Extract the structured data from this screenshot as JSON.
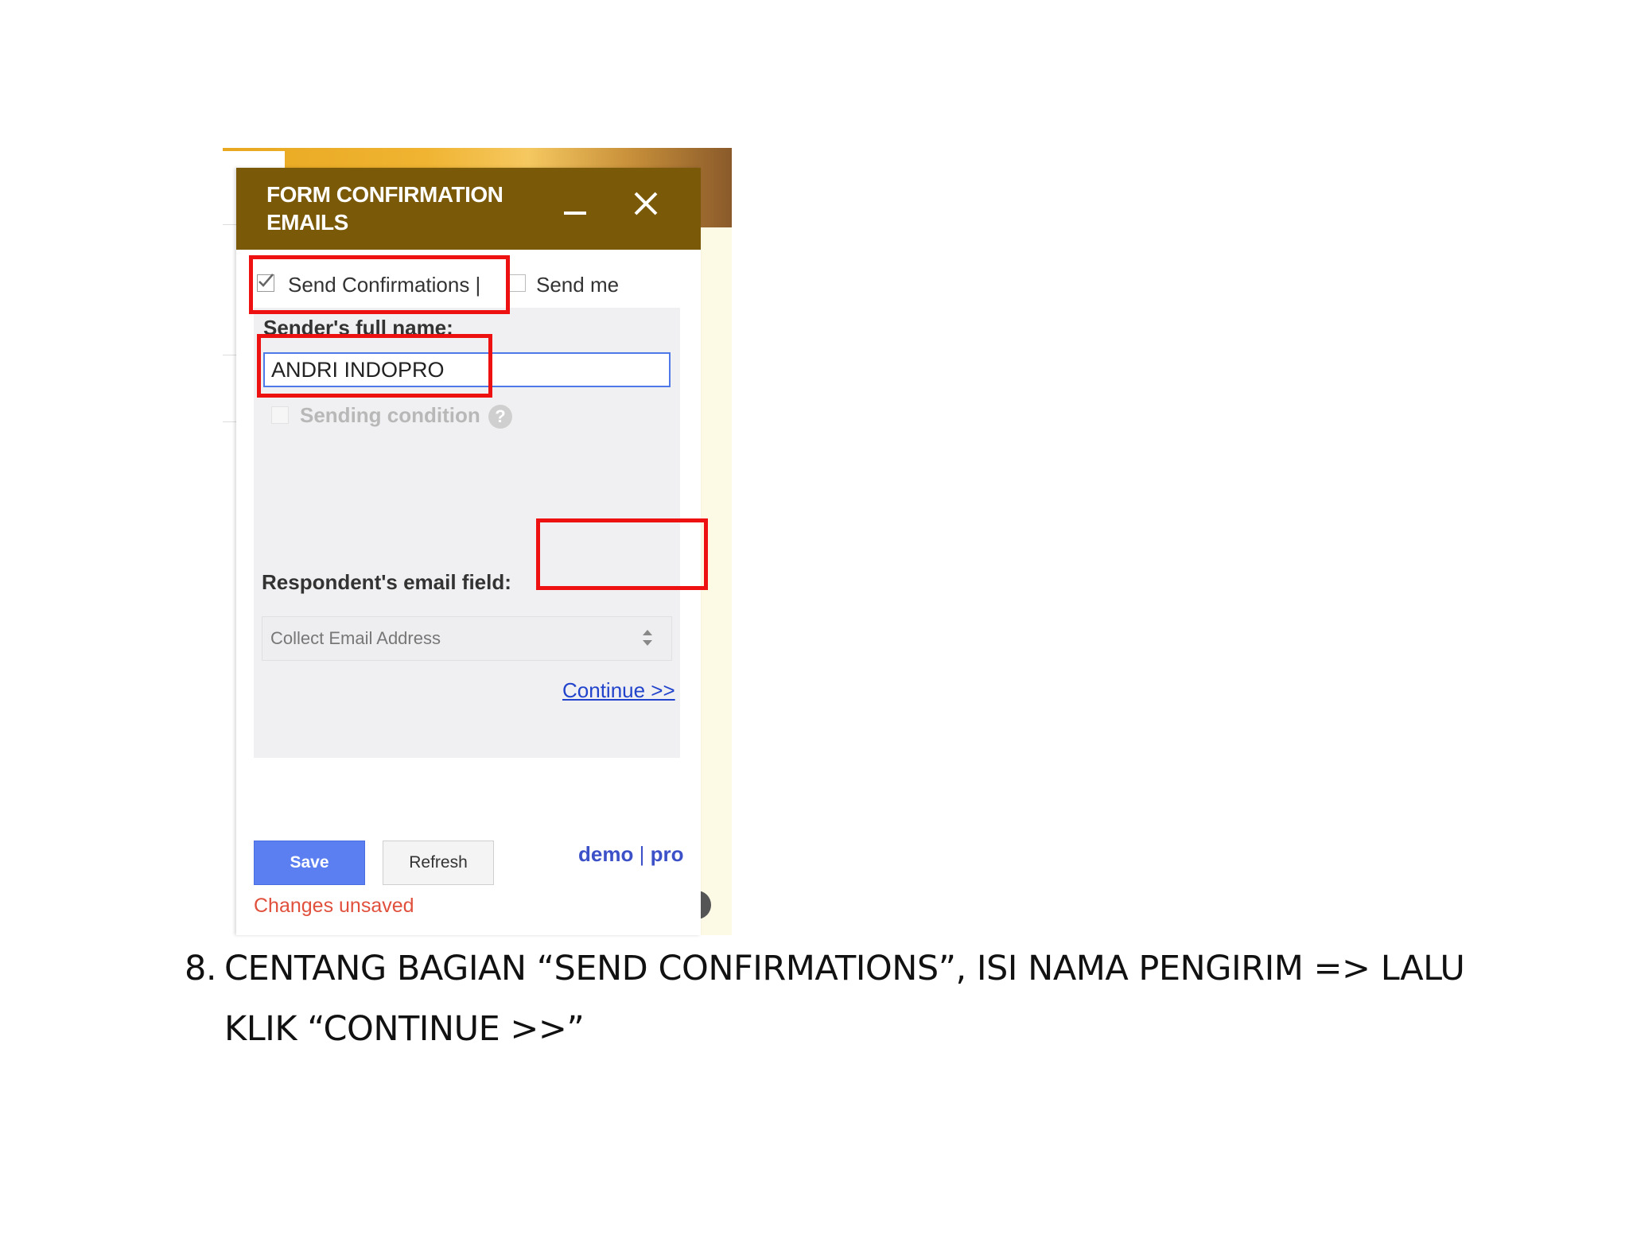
{
  "dialog": {
    "title": "FORM CONFIRMATION EMAILS",
    "tabs": {
      "send_confirmations": "Send Confirmations |",
      "send_confirmations_checked": true,
      "send_me": "Send me",
      "send_me_checked": false
    },
    "sender_label": "Sender's full name:",
    "sender_value": "ANDRI INDOPRO",
    "sending_condition": "Sending condition",
    "help_glyph": "?",
    "respondent_label": "Respondent's email field:",
    "respondent_select": "Collect Email Address",
    "continue": "Continue >>",
    "save": "Save",
    "refresh": "Refresh",
    "demo": "demo",
    "link_separator": "|",
    "pro": "pro",
    "status": "Changes unsaved"
  },
  "colors": {
    "header": "#7a5a08",
    "highlight": "#ee1111",
    "save_button": "#5b7ef0",
    "link": "#2244cc",
    "unsaved": "#e0503c"
  },
  "instruction": {
    "number": "8.",
    "text": "CENTANG BAGIAN “SEND CONFIRMATIONS”, ISI NAMA PENGIRIM => LALU KLIK “CONTINUE >>”"
  }
}
